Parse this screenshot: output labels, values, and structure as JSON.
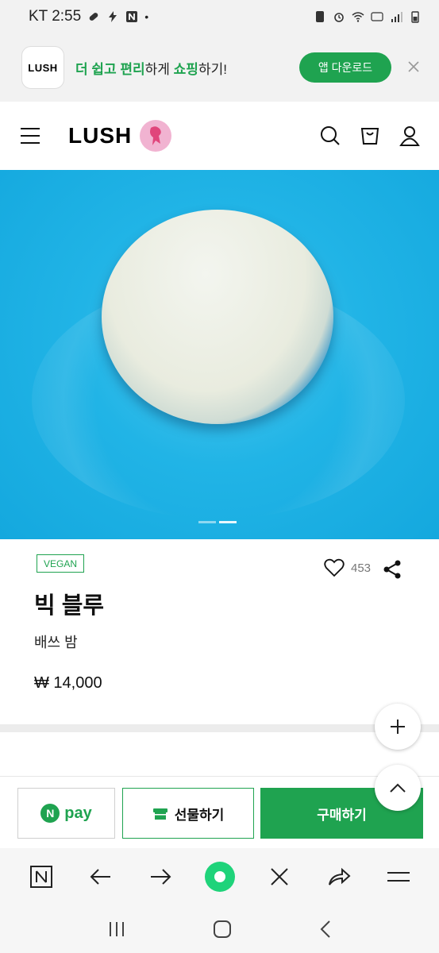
{
  "status_bar": {
    "time": "KT 2:55"
  },
  "app_banner": {
    "logo_text": "LUSH",
    "text_parts": [
      "더 쉽고 편리",
      "하게 ",
      "쇼핑",
      "하기!"
    ],
    "download_label": "앱 다운로드",
    "close_icon": "close-icon"
  },
  "header": {
    "logo": "LUSH",
    "icons": [
      "menu-icon",
      "search-icon",
      "cart-icon",
      "user-icon"
    ]
  },
  "product": {
    "badge": "VEGAN",
    "likes": "453",
    "name": "빅 블루",
    "category": "배쓰 밤",
    "price": "₩ 14,000",
    "image_indicator": {
      "total": 2,
      "active": 2
    }
  },
  "actions": {
    "npay_label": "pay",
    "gift_label": "선물하기",
    "buy_label": "구매하기"
  },
  "browser_bar": {
    "icons": [
      "naver-icon",
      "back-icon",
      "forward-icon",
      "home-icon",
      "close-icon",
      "share-icon",
      "menu-icon"
    ]
  },
  "colors": {
    "accent": "#1fa350",
    "hero_blue": "#21b4e6"
  }
}
